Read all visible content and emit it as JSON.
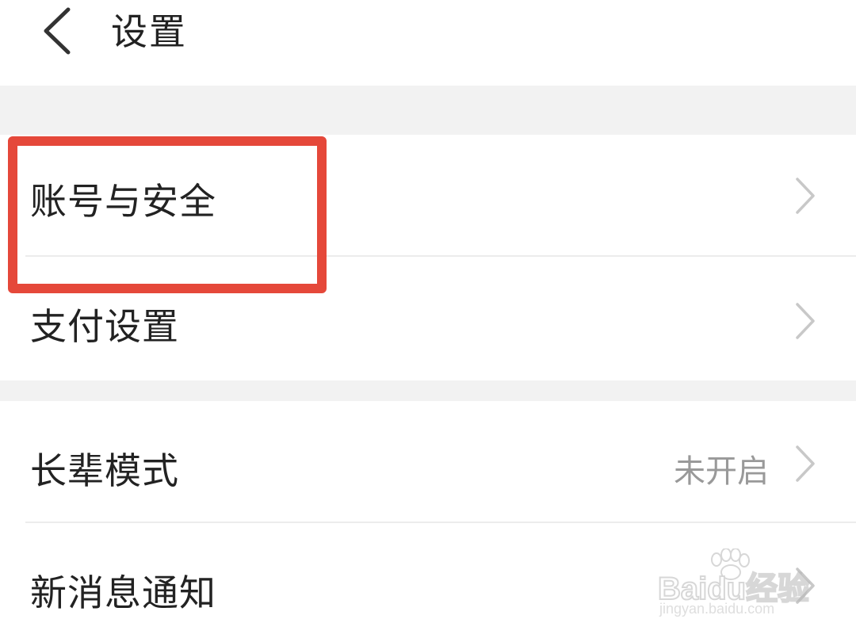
{
  "header": {
    "title": "设置",
    "back_icon": "chevron-left-icon"
  },
  "settings": {
    "items": [
      {
        "label": "账号与安全",
        "value": "",
        "icon": "chevron-right-icon"
      },
      {
        "label": "支付设置",
        "value": "",
        "icon": "chevron-right-icon"
      },
      {
        "label": "长辈模式",
        "value": "未开启",
        "icon": "chevron-right-icon"
      },
      {
        "label": "新消息通知",
        "value": "",
        "icon": "chevron-right-icon"
      }
    ]
  },
  "highlight": {
    "color": "#e5483a",
    "target": "账号与安全"
  },
  "watermark": {
    "brand": "Bai",
    "brand_suffix": "du",
    "brand_cn": "经验",
    "url": "jingyan.baidu.com"
  },
  "colors": {
    "text_primary": "#222222",
    "text_secondary": "#999999",
    "separator": "#f2f2f2",
    "chevron": "#c8c8c8"
  }
}
